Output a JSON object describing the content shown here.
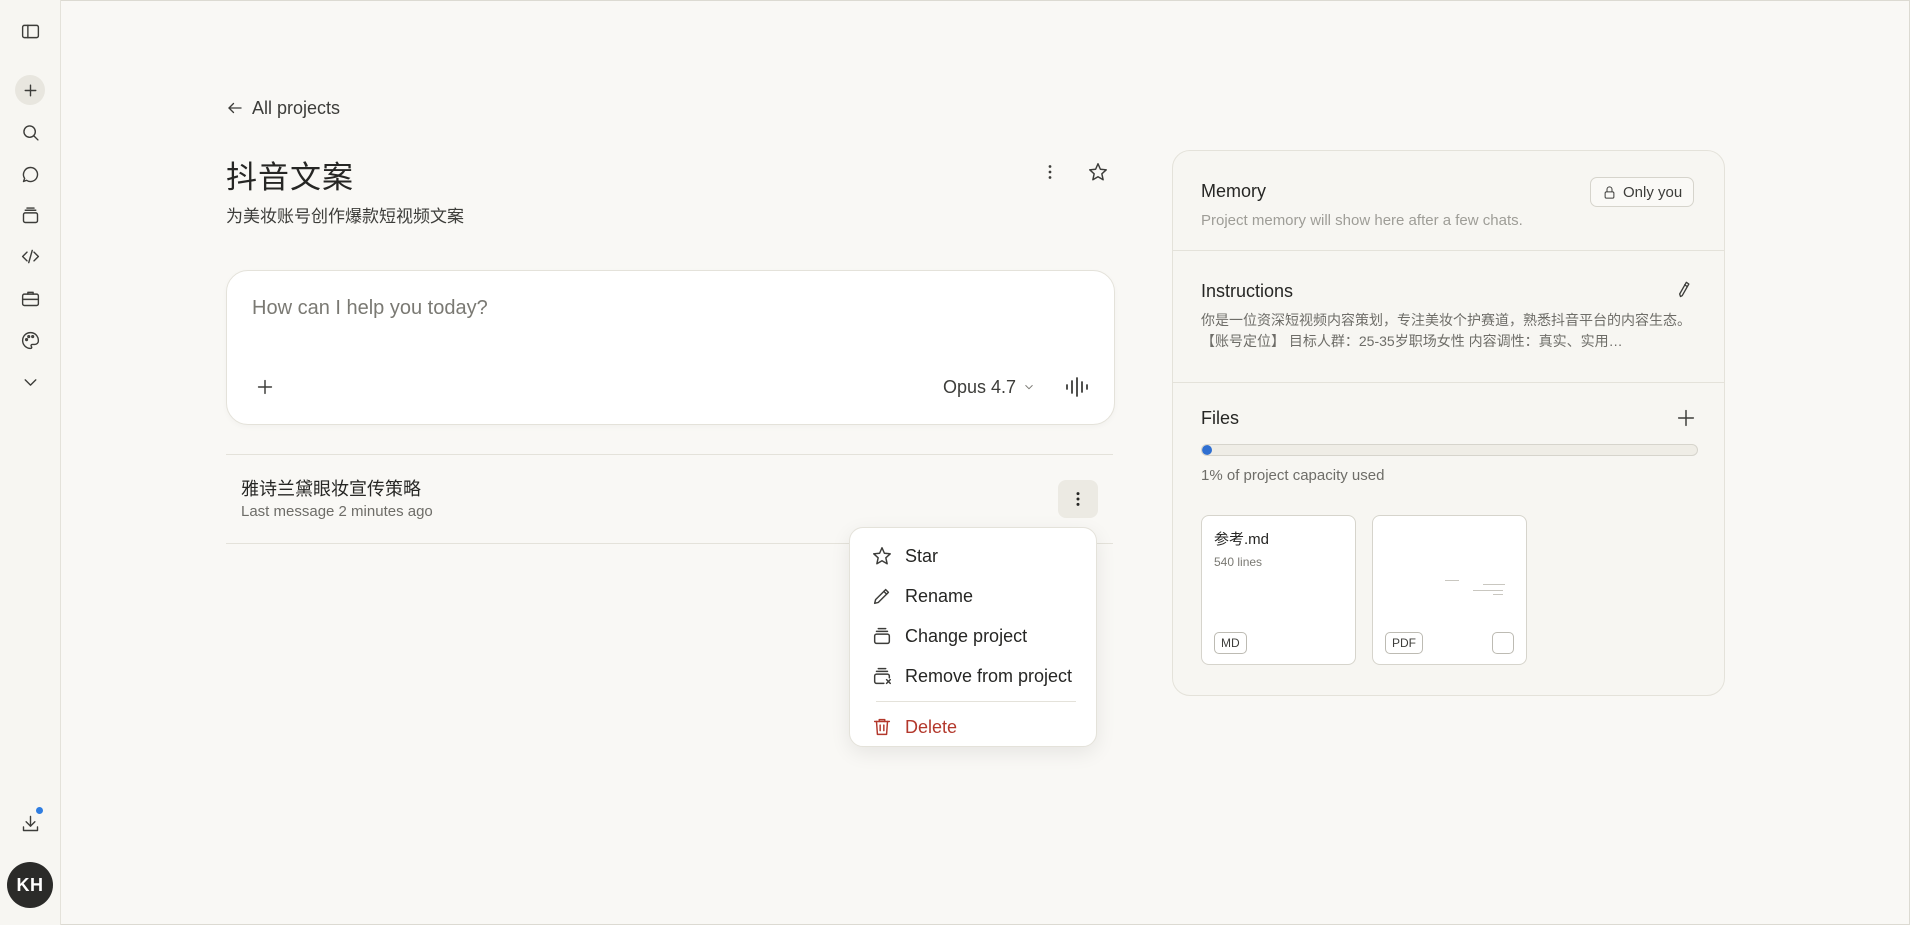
{
  "sidebar": {
    "avatar_initials": "KH",
    "icons": [
      "sidebar-toggle-icon",
      "plus-icon",
      "search-icon",
      "chat-icon",
      "projects-icon",
      "code-icon",
      "briefcase-icon",
      "palette-icon",
      "chevron-down-icon",
      "download-icon"
    ]
  },
  "header": {
    "back_label": "All projects",
    "title": "抖音文案",
    "description": "为美妆账号创作爆款短视频文案"
  },
  "composer": {
    "placeholder": "How can I help you today?",
    "model": "Opus 4.7"
  },
  "chats": [
    {
      "title": "雅诗兰黛眼妆宣传策略",
      "meta": "Last message 2 minutes ago"
    }
  ],
  "context_menu": {
    "items": [
      {
        "label": "Star",
        "icon": "star-icon"
      },
      {
        "label": "Rename",
        "icon": "pencil-icon"
      },
      {
        "label": "Change project",
        "icon": "project-icon"
      },
      {
        "label": "Remove from project",
        "icon": "project-remove-icon"
      }
    ],
    "danger_item": {
      "label": "Delete",
      "icon": "trash-icon"
    }
  },
  "panel": {
    "memory": {
      "title": "Memory",
      "visibility": "Only you",
      "subtitle": "Project memory will show here after a few chats."
    },
    "instructions": {
      "title": "Instructions",
      "text": "你是一位资深短视频内容策划，专注美妆个护赛道，熟悉抖音平台的内容生态。【账号定位】 目标人群：25-35岁职场女性 内容调性：真实、实用…"
    },
    "files": {
      "title": "Files",
      "capacity_percent": 1,
      "capacity_text": "1% of project capacity used",
      "items": [
        {
          "name": "参考.md",
          "lines": "540 lines",
          "type": "MD"
        },
        {
          "name": "",
          "lines": "",
          "type": "PDF"
        }
      ]
    }
  },
  "colors": {
    "accent": "#2f6fd1",
    "danger": "#b3382c",
    "notification": "#2f7de1"
  }
}
